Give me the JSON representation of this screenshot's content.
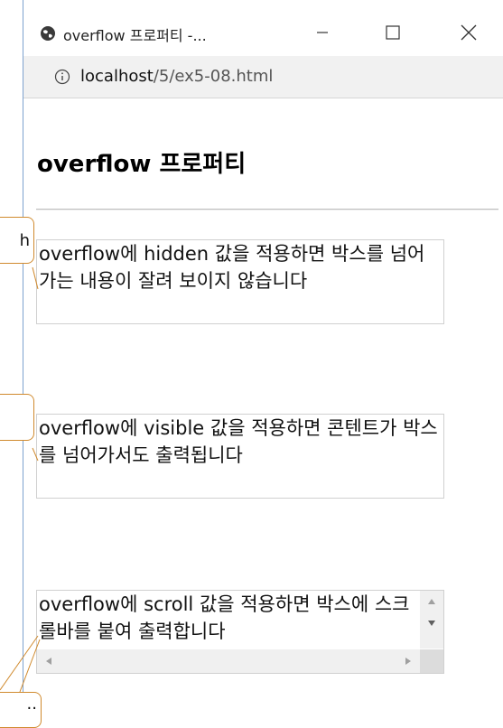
{
  "window": {
    "tab_title": "overflow 프로퍼티 -...",
    "url_host": "localhost",
    "url_path": "/5/ex5-08.html"
  },
  "page": {
    "heading": "overflow 프로퍼티"
  },
  "boxes": {
    "hidden_text": "overflow에 hidden 값을 적용하면 박스를 넘어가는 내용이 잘려 보이지 않습니다",
    "visible_text": "overflow에 visible 값을 적용하면 콘텐트가 박스를 넘어가서도 출력됩니다",
    "scroll_text": "overflow에 scroll 값을 적용하면 박스에 스크롤바를 붙여 출력합니다"
  },
  "callouts": {
    "top_fragment": "h",
    "bottom_fragment": ".."
  },
  "colors": {
    "callout_border": "#d08a2e",
    "window_border": "#7da2ce"
  }
}
